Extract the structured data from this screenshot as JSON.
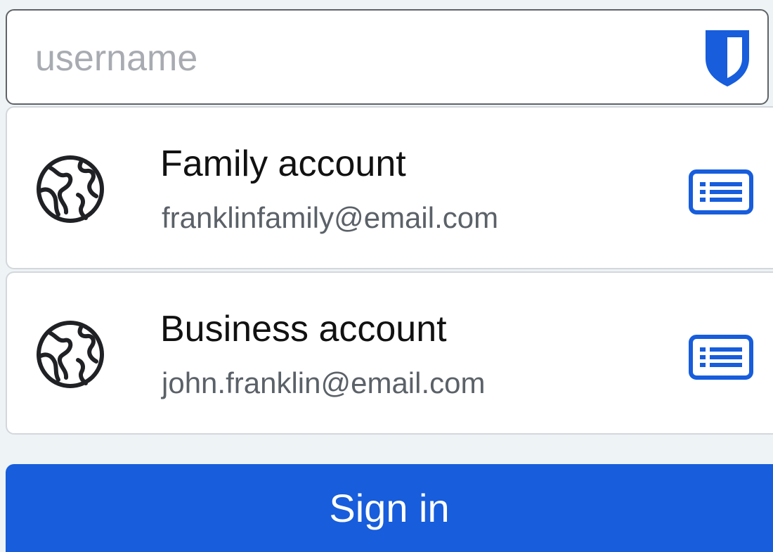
{
  "login_form": {
    "username_field": {
      "value": "",
      "placeholder": "username",
      "autofill_icon": "shield-icon"
    },
    "account_suggestions": [
      {
        "name": "Family account",
        "email": "franklinfamily@email.com",
        "icon": "globe-icon",
        "action_icon": "card-list-icon"
      },
      {
        "name": "Business account",
        "email": "john.franklin@email.com",
        "icon": "globe-icon",
        "action_icon": "card-list-icon"
      }
    ],
    "sign_in_button": {
      "label": "Sign in"
    }
  },
  "theme": {
    "accent": "#175ddc",
    "background": "#eef3f5",
    "surface": "#ffffff",
    "border": "#d3d7dc",
    "primary_text": "#111111",
    "secondary_text": "#5b6168",
    "placeholder_text": "#a8abb1"
  }
}
